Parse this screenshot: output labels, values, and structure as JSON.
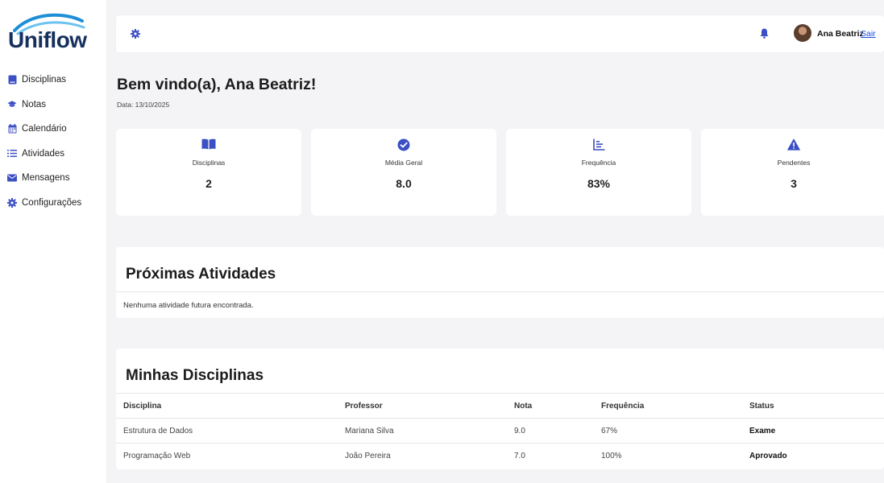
{
  "brand": {
    "name": "Uniflow"
  },
  "sidebar": {
    "items": [
      {
        "label": "Disciplinas",
        "icon": "book-icon"
      },
      {
        "label": "Notas",
        "icon": "graduation-cap-icon"
      },
      {
        "label": "Calendário",
        "icon": "calendar-icon"
      },
      {
        "label": "Atividades",
        "icon": "list-icon"
      },
      {
        "label": "Mensagens",
        "icon": "envelope-icon"
      },
      {
        "label": "Configurações",
        "icon": "gear-icon"
      }
    ]
  },
  "header": {
    "user_name": "Ana Beatriz",
    "logout_label": "Sair"
  },
  "welcome": {
    "title": "Bem vindo(a), Ana Beatriz!",
    "date": "Data: 13/10/2025"
  },
  "cards": [
    {
      "label": "Disciplinas",
      "value": "2",
      "icon": "open-book-icon"
    },
    {
      "label": "Média Geral",
      "value": "8.0",
      "icon": "check-circle-icon"
    },
    {
      "label": "Frequência",
      "value": "83%",
      "icon": "chart-icon"
    },
    {
      "label": "Pendentes",
      "value": "3",
      "icon": "warning-icon"
    }
  ],
  "activities": {
    "title": "Próximas Atividades",
    "empty_message": "Nenhuma atividade futura encontrada."
  },
  "disciplines": {
    "title": "Minhas Disciplinas",
    "columns": [
      "Disciplina",
      "Professor",
      "Nota",
      "Frequência",
      "Status"
    ],
    "rows": [
      [
        "Estrutura de Dados",
        "Mariana Silva",
        "9.0",
        "67%",
        "Exame"
      ],
      [
        "Programação Web",
        "João Pereira",
        "7.0",
        "100%",
        "Aprovado"
      ]
    ]
  },
  "colors": {
    "accent": "#3c4fc4",
    "brand": "#16305e",
    "link": "#1a4fe0"
  }
}
